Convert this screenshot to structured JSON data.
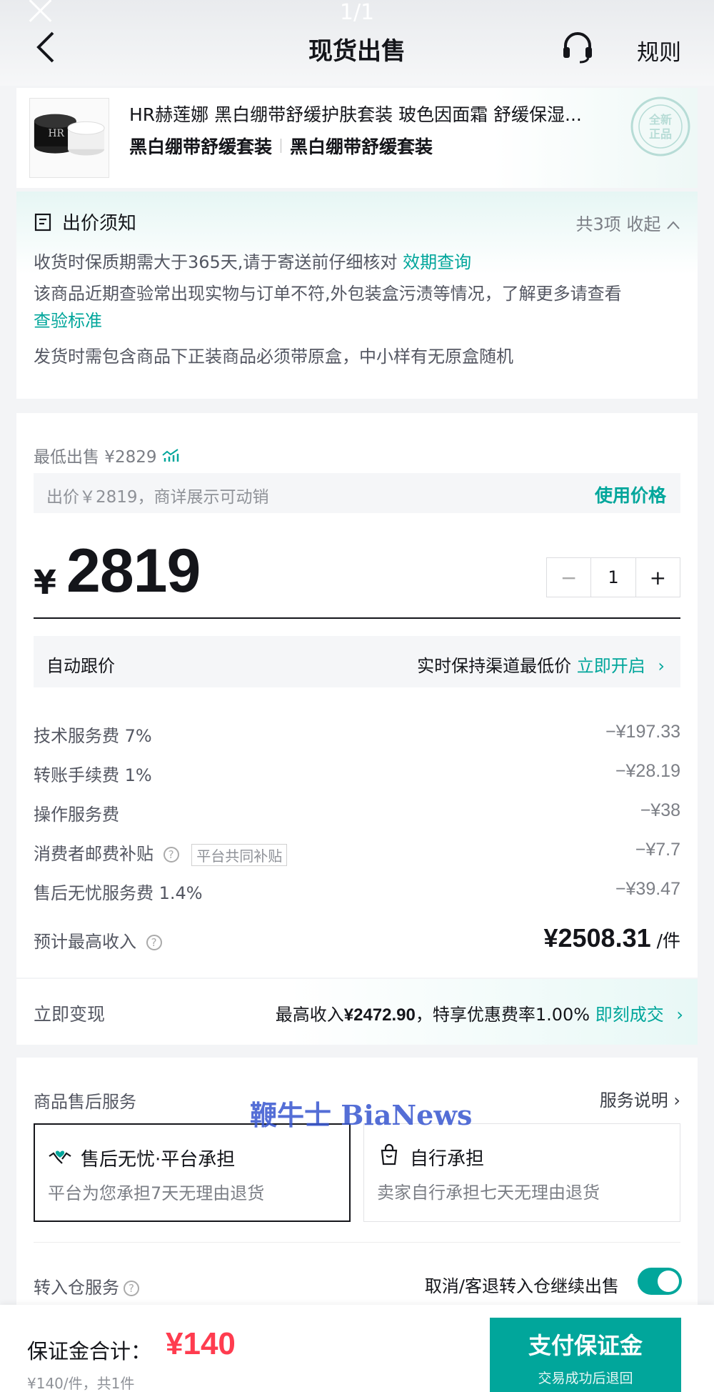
{
  "header": {
    "pager": "1/1",
    "title": "现货出售",
    "rules": "规则"
  },
  "product": {
    "name": "HR赫莲娜 黑白绷带舒缓护肤套装 玻色因面霜 舒缓保湿...",
    "spec1": "黑白绷带舒缓套装",
    "spec2": "黑白绷带舒缓套装",
    "stamp_text": "全新正品"
  },
  "notice": {
    "title": "出价须知",
    "count": "共3项 收起",
    "line1": "收货时保质期需大于365天,请于寄送前仔细核对 ",
    "line1_link": "效期查询",
    "line2": "该商品近期查验常出现实物与订单不符,外包装盒污渍等情况，了解更多请查看",
    "line2_link": "查验标准",
    "line3": "发货时需包含商品下正装商品必须带原盒，中小样有无原盒随机"
  },
  "price": {
    "lowest_label": "最低出售 ¥2829",
    "bid_hint": "出价￥2819，商详展示可动销",
    "use_price": "使用价格",
    "currency": "¥",
    "amount": "2819",
    "qty_minus": "−",
    "qty": "1",
    "qty_plus": "+"
  },
  "auto_follow": {
    "label": "自动跟价",
    "desc": "实时保持渠道最低价 ",
    "action": "立即开启",
    "chevron": "›"
  },
  "fees": [
    {
      "label": "技术服务费 7%",
      "amount": "−¥197.33"
    },
    {
      "label": "转账手续费 1%",
      "amount": "−¥28.19"
    },
    {
      "label": "操作服务费",
      "amount": "−¥38"
    },
    {
      "label": "消费者邮费补贴",
      "tag": "平台共同补贴",
      "amount": "−¥7.7"
    },
    {
      "label": "售后无忧服务费 1.4%",
      "amount": "−¥39.47"
    }
  ],
  "income": {
    "label": "预计最高收入",
    "value": "¥2508.31",
    "unit": " /件"
  },
  "cash": {
    "label": "立即变现",
    "prefix": "最高收入",
    "amount": "¥2472.90",
    "suffix": "，特享优惠费率1.00% ",
    "action": "即刻成交",
    "chevron": "›"
  },
  "service": {
    "title": "商品售后服务",
    "explain": "服务说明 ›",
    "opt1_title": "售后无忧·平台承担",
    "opt1_desc": "平台为您承担7天无理由退货",
    "opt2_title": "自行承担",
    "opt2_desc": "卖家自行承担七天无理由退货",
    "transfer_label": "转入仓服务",
    "transfer_right": "取消/客退转入仓继续出售"
  },
  "watermark": "鞭牛士 BiaNews",
  "bottom": {
    "deposit_label": "保证金合计：",
    "deposit_value": "¥140",
    "deposit_sub": "¥140/件，共1件",
    "pay_label": "支付保证金",
    "pay_sub": "交易成功后退回"
  },
  "colors": {
    "accent": "#01a69b",
    "price_red": "#ff3c4f"
  }
}
